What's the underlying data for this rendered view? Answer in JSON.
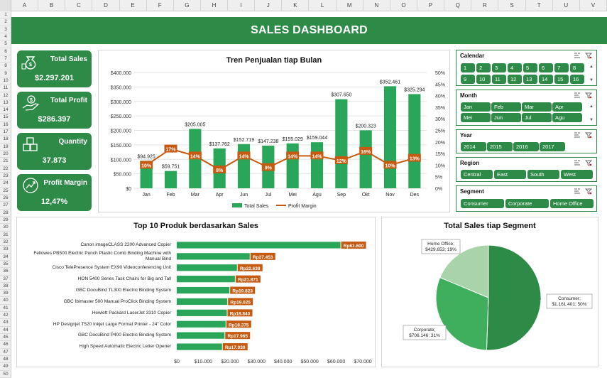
{
  "sheet": {
    "columns": [
      "A",
      "B",
      "C",
      "D",
      "E",
      "F",
      "G",
      "H",
      "I",
      "J",
      "K",
      "L",
      "M",
      "N",
      "O",
      "P",
      "Q",
      "R",
      "S",
      "T",
      "U",
      "V"
    ],
    "rows": [
      "1",
      "2",
      "3",
      "4",
      "5",
      "6",
      "7",
      "8",
      "9",
      "10",
      "11",
      "12",
      "13",
      "14",
      "15",
      "16",
      "17",
      "18",
      "19",
      "20",
      "21",
      "22",
      "23",
      "24",
      "25",
      "26",
      "27",
      "28",
      "29",
      "30",
      "31",
      "32",
      "33",
      "34",
      "35",
      "36",
      "37",
      "38",
      "39",
      "40",
      "41",
      "42",
      "43",
      "44",
      "45",
      "46",
      "47",
      "48",
      "49",
      "50"
    ]
  },
  "dashboard": {
    "title": "SALES DASHBOARD",
    "accent": "#2e8b47",
    "bar_color": "#2aa65a",
    "line_color": "#c55a11"
  },
  "kpis": [
    {
      "label": "Total Sales",
      "value": "$2.297.201",
      "icon": "money-bag-icon"
    },
    {
      "label": "Total Profit",
      "value": "$286.397",
      "icon": "hand-money-icon"
    },
    {
      "label": "Quantity",
      "value": "37.873",
      "icon": "boxes-icon"
    },
    {
      "label": "Profit Margin",
      "value": "12,47%",
      "icon": "growth-globe-icon"
    }
  ],
  "slicers": {
    "calendar": {
      "title": "Calendar",
      "items": [
        "1",
        "2",
        "3",
        "4",
        "5",
        "6",
        "7",
        "8",
        "9",
        "10",
        "11",
        "12",
        "13",
        "14",
        "15",
        "16"
      ]
    },
    "month": {
      "title": "Month",
      "items": [
        "Jan",
        "Feb",
        "Mar",
        "Apr",
        "Mei",
        "Jun",
        "Jul",
        "Agu"
      ]
    },
    "year": {
      "title": "Year",
      "items": [
        "2014",
        "2015",
        "2016",
        "2017"
      ]
    },
    "region": {
      "title": "Region",
      "items": [
        "Central",
        "East",
        "South",
        "West"
      ]
    },
    "segment": {
      "title": "Segment",
      "items": [
        "Consumer",
        "Corporate",
        "Home Office"
      ]
    }
  },
  "chart_data": [
    {
      "type": "bar",
      "title": "Tren Penjualan tiap Bulan",
      "categories": [
        "Jan",
        "Feb",
        "Mar",
        "Apr",
        "Jun",
        "Jul",
        "Mei",
        "Agu",
        "Sep",
        "Okt",
        "Nov",
        "Des"
      ],
      "series": [
        {
          "name": "Total Sales",
          "type": "bar",
          "axis": "left",
          "values": [
            94925,
            59751,
            205005,
            137762,
            152719,
            147238,
            155029,
            159044,
            307650,
            200323,
            352461,
            325294
          ],
          "labels": [
            "$94.925",
            "$59.751",
            "$205.005",
            "$137.762",
            "$152.719",
            "$147.238",
            "$155.029",
            "$159.044",
            "$307.650",
            "$200.323",
            "$352.461",
            "$325.294"
          ]
        },
        {
          "name": "Profit Margin",
          "type": "line",
          "axis": "right",
          "values": [
            10,
            17,
            14,
            8,
            14,
            9,
            14,
            14,
            12,
            16,
            10,
            13
          ],
          "labels": [
            "10%",
            "17%",
            "14%",
            "8%",
            "14%",
            "9%",
            "14%",
            "14%",
            "12%",
            "16%",
            "10%",
            "13%"
          ]
        }
      ],
      "ylim": [
        0,
        400000
      ],
      "y_ticks": [
        "$0",
        "$50.000",
        "$100.000",
        "$150.000",
        "$200.000",
        "$250.000",
        "$300.000",
        "$350.000",
        "$400.000"
      ],
      "y2lim": [
        0,
        50
      ],
      "y2_ticks": [
        "0%",
        "5%",
        "10%",
        "15%",
        "20%",
        "25%",
        "30%",
        "35%",
        "40%",
        "45%",
        "50%"
      ],
      "grid": true,
      "legend": "bottom"
    },
    {
      "type": "bar",
      "orientation": "horizontal",
      "title": "Top 10 Produk berdasarkan Sales",
      "categories": [
        "Canon imageCLASS 2200 Advanced Copier",
        "Fellowes PB500 Electric Punch Plastic Comb Binding Machine with Manual Bind",
        "Cisco TelePresence System EX90 Videoconferencing Unit",
        "HON 5400 Series Task Chairs for Big and Tall",
        "GBC DocuBind TL300 Electric Binding System",
        "GBC Ibimaster 500 Manual ProClick Binding System",
        "Hewlett Packard LaserJet 3310 Copier",
        "HP Designjet T520 Inkjet Large Format Printer - 24\" Color",
        "GBC DocuBind P400 Electric Binding System",
        "High Speed Automatic Electric Letter Opener"
      ],
      "values": [
        61600,
        27453,
        22638,
        21871,
        19823,
        19025,
        18840,
        18375,
        17965,
        17030
      ],
      "labels": [
        "Rp61.600",
        "Rp27.453",
        "Rp22.638",
        "Rp21.871",
        "Rp19.823",
        "Rp19.025",
        "Rp18.840",
        "Rp18.375",
        "Rp17.965",
        "Rp17.030"
      ],
      "xlim": [
        0,
        70000
      ],
      "x_ticks": [
        "$0",
        "$10.000",
        "$20.000",
        "$30.000",
        "$40.000",
        "$50.000",
        "$60.000",
        "$70.000"
      ],
      "grid": false
    },
    {
      "type": "pie",
      "title": "Total Sales tiap Segment",
      "categories": [
        "Consumer",
        "Corporate",
        "Home Office"
      ],
      "values": [
        1161401,
        706146,
        429653
      ],
      "percent": [
        50,
        31,
        19
      ],
      "labels": [
        "Consumer; $1.161.401; 50%",
        "Corporate; $706.146; 31%",
        "Home Office; $429.653; 19%"
      ],
      "colors": [
        "#2e8b47",
        "#3fae5d",
        "#a9d3a9"
      ]
    }
  ]
}
